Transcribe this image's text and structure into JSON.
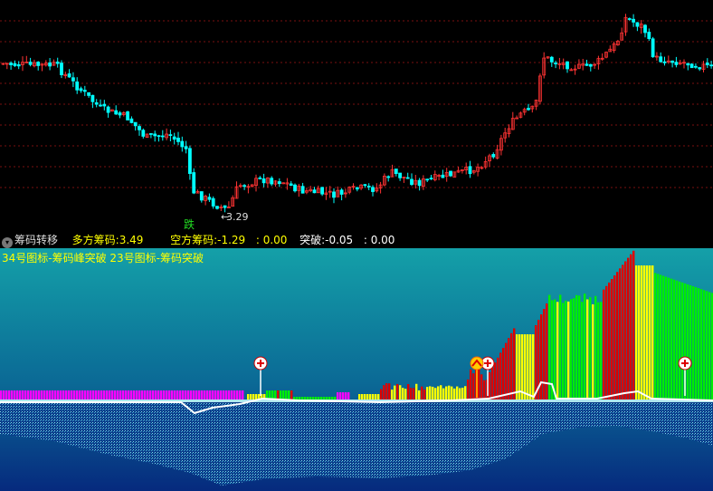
{
  "status": {
    "indicator_name": "筹码转移",
    "long_label": "多方筹码: ",
    "long_value": "3.49",
    "short_label": "空方筹码: ",
    "short_value": "-1.29",
    "short_extra": " : 0.00",
    "break_label": "突破: ",
    "break_value": "-0.05",
    "break_extra": " : 0.00"
  },
  "candle": {
    "low_label": "3.29",
    "fall_tag": "跌"
  },
  "indicator": {
    "title": "34号图标-筹码峰突破 23号图标-筹码突破"
  },
  "colors": {
    "up": "#ff3333",
    "down": "#00ffff",
    "grid": "#7a1010",
    "yellow": "#ffff00",
    "magenta": "#ff00ff",
    "green": "#00ee00",
    "red": "#dd0000",
    "white": "#ffffff",
    "panel_top": "#14a0a8",
    "panel_bottom": "#062a7e"
  }
}
